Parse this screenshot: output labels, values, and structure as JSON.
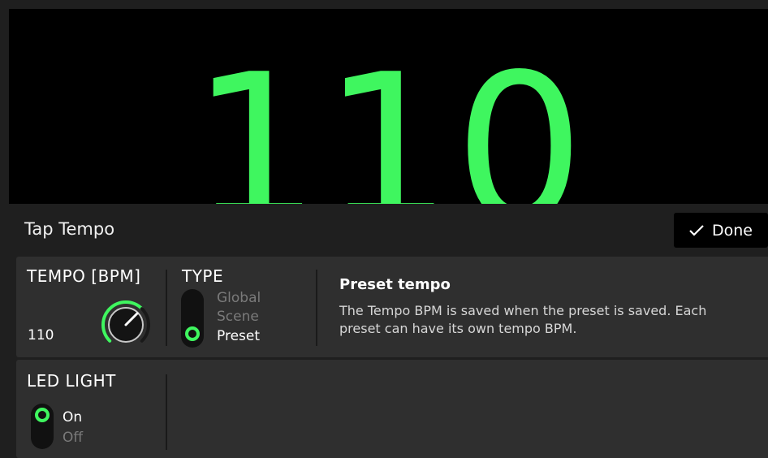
{
  "display": {
    "bpm": "110"
  },
  "header": {
    "title": "Tap Tempo",
    "done_label": "Done"
  },
  "tempo": {
    "title": "TEMPO [BPM]",
    "value": "110"
  },
  "type": {
    "title": "TYPE",
    "options": [
      "Global",
      "Scene",
      "Preset"
    ],
    "selected": "Preset"
  },
  "info": {
    "title": "Preset tempo",
    "body": "The Tempo BPM is saved when the preset is saved. Each preset can have its own tempo BPM."
  },
  "led": {
    "title": "LED LIGHT",
    "options": [
      "On",
      "Off"
    ],
    "selected": "On"
  },
  "colors": {
    "accent": "#3ff65f",
    "background": "#1f1f1f",
    "panel": "#2f2f2f"
  }
}
